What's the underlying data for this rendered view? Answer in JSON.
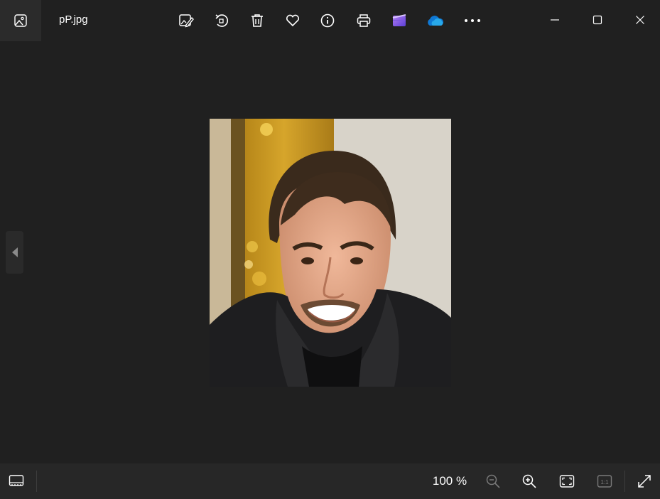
{
  "window": {
    "file_name": "pP.jpg"
  },
  "toolbar": {
    "items": [
      {
        "icon": "edit-image-icon"
      },
      {
        "icon": "rotate-icon"
      },
      {
        "icon": "delete-icon"
      },
      {
        "icon": "favorite-heart-icon"
      },
      {
        "icon": "info-icon"
      },
      {
        "icon": "print-icon"
      },
      {
        "icon": "clipchamp-icon"
      },
      {
        "icon": "onedrive-cloud-icon"
      },
      {
        "icon": "more-options-icon"
      }
    ],
    "accent_onedrive": "#0f78d4",
    "accent_clipchamp": "#8e5de8"
  },
  "window_controls": [
    "minimize-icon",
    "maximize-icon",
    "close-icon"
  ],
  "viewer": {
    "background": "#202020",
    "photo_subject": "portrait photo"
  },
  "statusbar": {
    "zoom": "100 %",
    "buttons": [
      "filmstrip-icon",
      "zoom-out-icon",
      "zoom-in-icon",
      "fit-to-window-icon",
      "actual-size-icon",
      "fullscreen-icon"
    ],
    "actual_size_label": "1:1"
  }
}
